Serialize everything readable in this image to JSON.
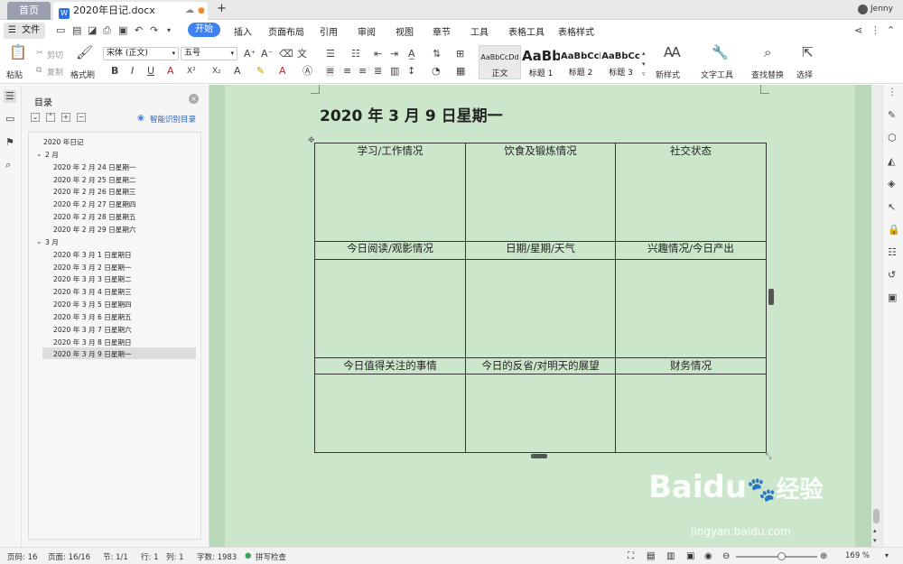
{
  "tabs": {
    "home": "首页",
    "doc": "2020年日记.docx",
    "doc_badge": "W",
    "add": "+",
    "user": "Jenny"
  },
  "menu": {
    "file": "文件",
    "items": [
      "开始",
      "插入",
      "页面布局",
      "引用",
      "审阅",
      "视图",
      "章节",
      "工具",
      "表格工具",
      "表格样式"
    ]
  },
  "toolbar": {
    "paste": "粘贴",
    "cut": "剪切",
    "copy": "复制",
    "format_painter": "格式刷",
    "font": "宋体 (正文)",
    "size": "五号",
    "styles": [
      {
        "sample": "AaBbCcDd",
        "name": "正文"
      },
      {
        "sample": "AaBb(",
        "name": "标题 1"
      },
      {
        "sample": "AaBbCcI",
        "name": "标题 2"
      },
      {
        "sample": "AaBbCc",
        "name": "标题 3"
      }
    ],
    "new_style": "新样式",
    "text_tools": "文字工具",
    "find_replace": "查找替换",
    "select": "选择"
  },
  "nav": {
    "title": "目录",
    "smart": "智能识别目录",
    "items": [
      {
        "text": "2020 年日记",
        "level": 0
      },
      {
        "text": "2 月",
        "level": 1
      },
      {
        "text": "2020 年 2 月 24 日星期一",
        "level": 2
      },
      {
        "text": "2020 年 2 月 25 日星期二",
        "level": 2
      },
      {
        "text": "2020 年 2 月 26 日星期三",
        "level": 2
      },
      {
        "text": "2020 年 2 月 27 日星期四",
        "level": 2
      },
      {
        "text": "2020 年 2 月 28 日星期五",
        "level": 2
      },
      {
        "text": "2020 年 2 月 29 日星期六",
        "level": 2
      },
      {
        "text": "3 月",
        "level": 1
      },
      {
        "text": "2020 年 3 月 1 日星期日",
        "level": 2
      },
      {
        "text": "2020 年 3 月 2 日星期一",
        "level": 2
      },
      {
        "text": "2020 年 3 月 3 日星期二",
        "level": 2
      },
      {
        "text": "2020 年 3 月 4 日星期三",
        "level": 2
      },
      {
        "text": "2020 年 3 月 5 日星期四",
        "level": 2
      },
      {
        "text": "2020 年 3 月 6 日星期五",
        "level": 2
      },
      {
        "text": "2020 年 3 月 7 日星期六",
        "level": 2
      },
      {
        "text": "2020 年 3 月 8 日星期日",
        "level": 2
      },
      {
        "text": "2020 年 3 月 9 日星期一",
        "level": 2
      }
    ],
    "selected": "2020 年 3 月 9 日星期一"
  },
  "document": {
    "heading": "2020 年 3 月 9 日星期一",
    "table": [
      [
        "学习/工作情况",
        "饮食及锻炼情况",
        "社交状态"
      ],
      [
        "今日阅读/观影情况",
        "日期/星期/天气",
        "兴趣情况/今日产出"
      ],
      [
        "今日值得关注的事情",
        "今日的反省/对明天的展望",
        "财务情况"
      ]
    ]
  },
  "status": {
    "page_num": "页码: 16",
    "pages": "页面: 16/16",
    "section": "节: 1/1",
    "row": "行: 1",
    "col": "列: 1",
    "word_count": "字数: 1983",
    "spell_check": "拼写检查",
    "zoom": "169 %",
    "zoom_fraction": 0.55
  },
  "watermark": {
    "brand": "Baidu",
    "brand_cn": "经验",
    "url": "jingyan.baidu.com"
  },
  "colors": {
    "accent": "#3d82f0",
    "page": "#cce6cc",
    "canvas": "#b8d8b9"
  }
}
